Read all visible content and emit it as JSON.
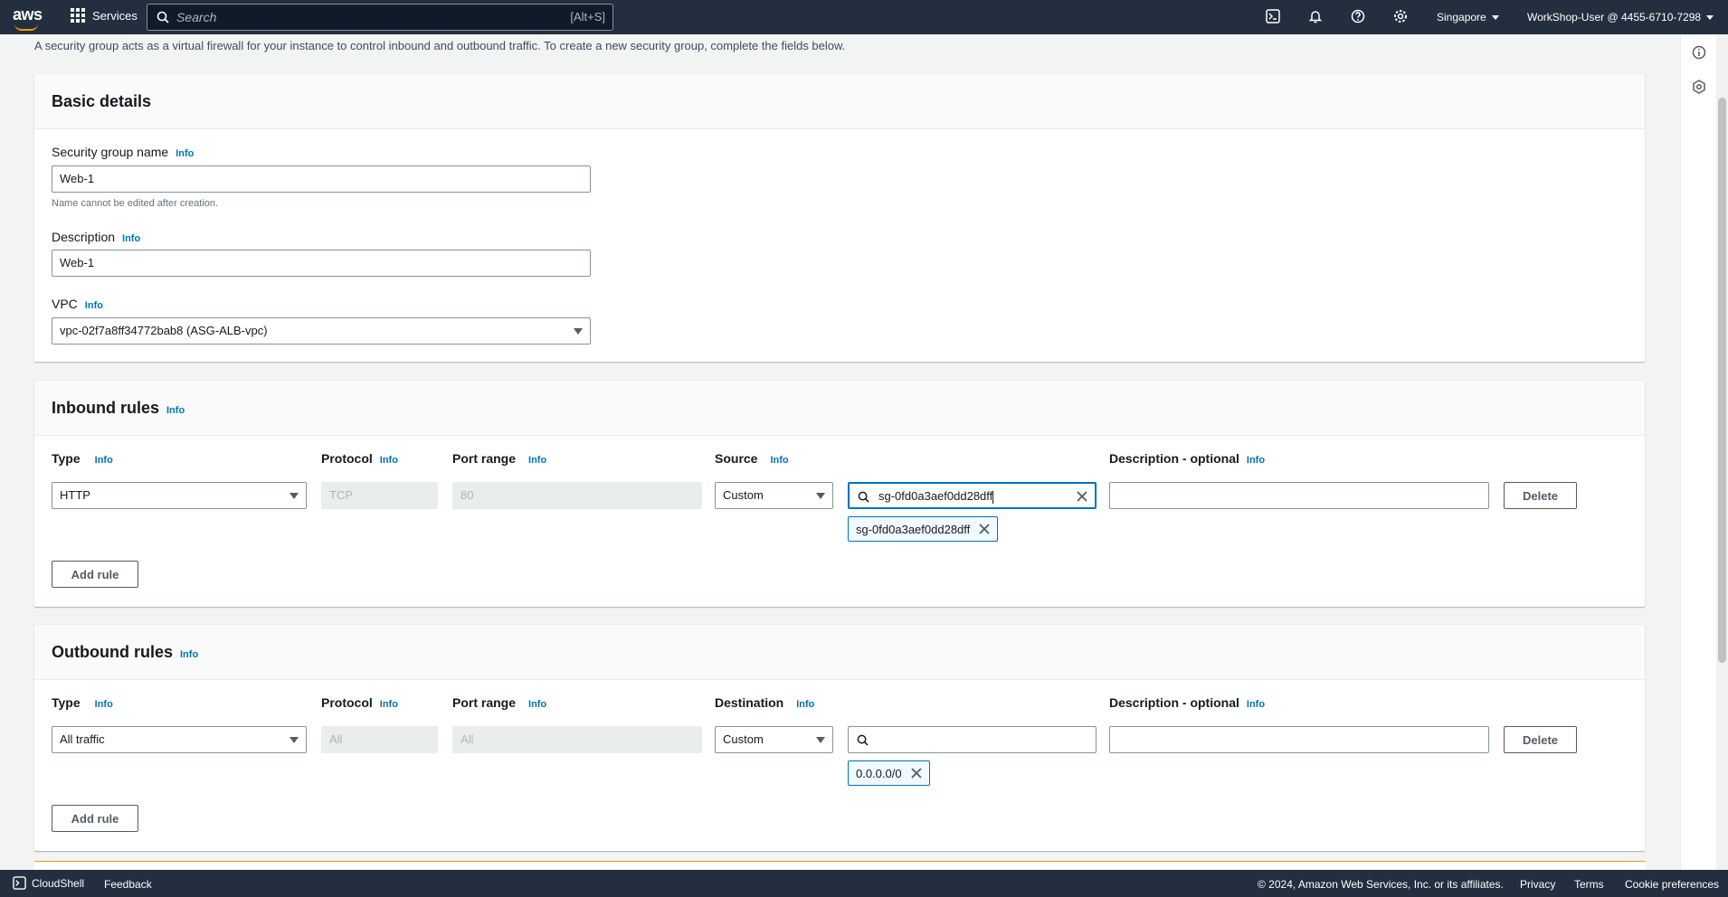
{
  "topbar": {
    "logo": "aws",
    "services_label": "Services",
    "search_placeholder": "Search",
    "search_shortcut": "[Alt+S]",
    "region": "Singapore",
    "user": "WorkShop-User @ 4455-6710-7298",
    "icons": [
      "grid-icon",
      "search-icon",
      "cloudshell-icon",
      "bell-icon",
      "help-icon",
      "gear-icon"
    ]
  },
  "intro": "A security group acts as a virtual firewall for your instance to control inbound and outbound traffic. To create a new security group, complete the fields below.",
  "basic": {
    "title": "Basic details",
    "name_label": "Security group name",
    "name_value": "Web-1",
    "name_hint": "Name cannot be edited after creation.",
    "desc_label": "Description",
    "desc_value": "Web-1",
    "vpc_label": "VPC",
    "vpc_value": "vpc-02f7a8ff34772bab8 (ASG-ALB-vpc)"
  },
  "info": "Info",
  "inbound": {
    "title": "Inbound rules",
    "cols": {
      "type": "Type",
      "protocol": "Protocol",
      "port": "Port range",
      "source": "Source",
      "desc": "Description - optional"
    },
    "row": {
      "type": "HTTP",
      "protocol": "TCP",
      "port": "80",
      "source": "Custom",
      "search_value": "sg-0fd0a3aef0dd28dff",
      "token": "sg-0fd0a3aef0dd28dff",
      "desc": ""
    },
    "delete": "Delete",
    "add_rule": "Add rule"
  },
  "outbound": {
    "title": "Outbound rules",
    "cols": {
      "type": "Type",
      "protocol": "Protocol",
      "port": "Port range",
      "dest": "Destination",
      "desc": "Description - optional"
    },
    "row": {
      "type": "All traffic",
      "protocol": "All",
      "port": "All",
      "dest": "Custom",
      "search_value": "",
      "token": "0.0.0.0/0",
      "desc": ""
    },
    "delete": "Delete",
    "add_rule": "Add rule"
  },
  "footer": {
    "cloudshell": "CloudShell",
    "feedback": "Feedback",
    "copyright": "© 2024, Amazon Web Services, Inc. or its affiliates.",
    "privacy": "Privacy",
    "terms": "Terms",
    "cookie": "Cookie preferences"
  }
}
